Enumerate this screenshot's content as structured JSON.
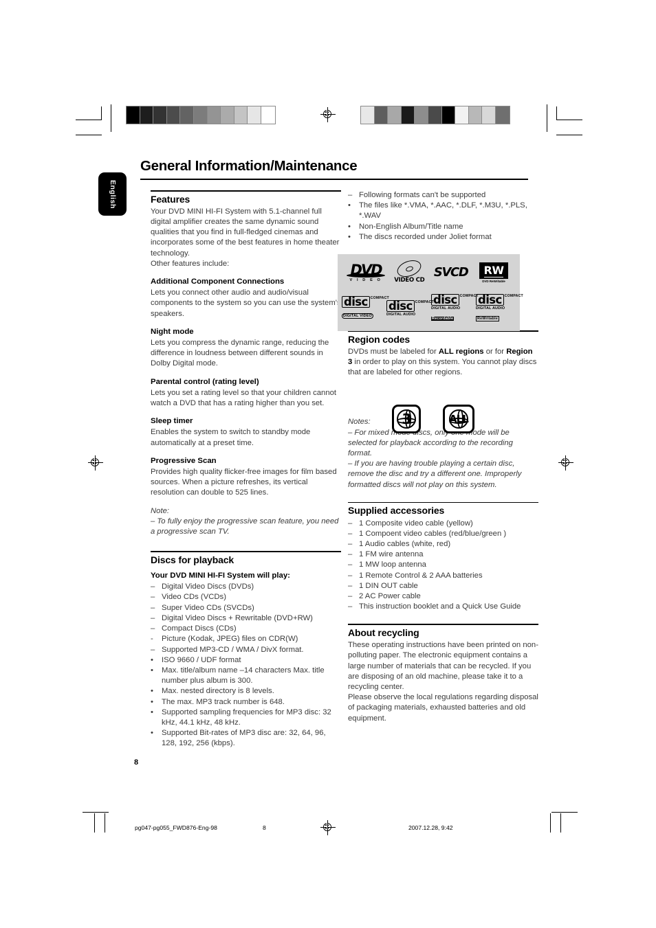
{
  "document": {
    "title": "General Information/Maintenance",
    "language_tab": "English",
    "page_number": "8"
  },
  "footer": {
    "filename": "pg047-pg055_FWD876-Eng-98",
    "page": "8",
    "timestamp": "2007.12.28, 9:42"
  },
  "left_column": {
    "features": {
      "heading": "Features",
      "intro": "Your DVD MINI HI-FI System with 5.1-channel full digital amplifier creates the same dynamic sound qualities that you find in full-fledged cinemas and incorporates some of the best features in home theater technology.",
      "intro2": "Other features include:",
      "items": [
        {
          "title": "Additional Component Connections",
          "body": "Lets you connect other audio and audio/visual components to the system so you can use the system's speakers."
        },
        {
          "title": "Night mode",
          "body": "Lets you compress the dynamic range, reducing the difference in loudness between different sounds in Dolby Digital mode."
        },
        {
          "title": "Parental control (rating level)",
          "body": "Lets you set a rating level so that your children cannot watch a DVD that has a rating higher than you set."
        },
        {
          "title": "Sleep timer",
          "body": "Enables the system to switch to standby mode automatically at a preset time."
        },
        {
          "title": "Progressive Scan",
          "body": "Provides high quality flicker-free images for film based sources.  When a picture refreshes, its vertical resolution can double to 525 lines."
        }
      ],
      "note_label": "Note:",
      "note_text": "–  To fully enjoy the progressive scan feature, you need a progressive scan TV."
    },
    "discs": {
      "heading": "Discs for playback",
      "subheading": "Your DVD MINI HI-FI System will play:",
      "list": [
        {
          "marker": "–",
          "text": "Digital Video Discs (DVDs)"
        },
        {
          "marker": "–",
          "text": "Video CDs (VCDs)"
        },
        {
          "marker": "–",
          "text": "Super Video CDs (SVCDs)"
        },
        {
          "marker": "–",
          "text": "Digital Video Discs + Rewritable (DVD+RW)"
        },
        {
          "marker": "–",
          "text": "Compact Discs (CDs)"
        },
        {
          "marker": "-",
          "text": "Picture (Kodak, JPEG) files on CDR(W)"
        },
        {
          "marker": "–",
          "text": "Supported MP3-CD / WMA / DivX format."
        },
        {
          "marker": "•",
          "text": "ISO 9660 / UDF format"
        },
        {
          "marker": "•",
          "text": "Max. title/album name –14 characters Max. title number plus album is 300."
        },
        {
          "marker": "•",
          "text": "Max. nested directory is 8 levels."
        },
        {
          "marker": "•",
          "text": "The max. MP3 track number is 648."
        },
        {
          "marker": "•",
          "text": "Supported sampling frequencies for MP3 disc: 32 kHz, 44.1 kHz, 48 kHz."
        },
        {
          "marker": "•",
          "text": "Supported Bit-rates of MP3 disc are: 32, 64, 96, 128, 192, 256 (kbps)."
        }
      ]
    }
  },
  "right_column": {
    "unsupported": [
      {
        "marker": "–",
        "text": "Following formats can't be supported"
      },
      {
        "marker": "•",
        "text": "The files like *.VMA, *.AAC, *.DLF, *.M3U, *.PLS, *.WAV"
      },
      {
        "marker": "•",
        "text": "Non-English Album/Title name"
      },
      {
        "marker": "•",
        "text": "The discs recorded under Joliet format"
      }
    ],
    "logo_panel": {
      "logos": [
        {
          "name": "dvd-video-logo",
          "primary": "DVD",
          "secondary": "V I D E O"
        },
        {
          "name": "video-cd-logo",
          "primary": "",
          "secondary": "VIDEO CD"
        },
        {
          "name": "svcd-logo",
          "primary": "SVCD",
          "secondary": ""
        },
        {
          "name": "dvd-rewritable-logo",
          "primary": "RW",
          "secondary": "DVD ReWritable"
        },
        {
          "name": "compact-disc-digital-video-logo",
          "top": "COMPACT",
          "primary": "disc",
          "secondary": "DIGITAL VIDEO",
          "tertiary": ""
        },
        {
          "name": "compact-disc-digital-audio-logo",
          "top": "COMPACT",
          "primary": "disc",
          "secondary": "DIGITAL AUDIO",
          "tertiary": ""
        },
        {
          "name": "compact-disc-recordable-logo",
          "top": "COMPACT",
          "primary": "disc",
          "secondary": "DIGITAL AUDIO",
          "tertiary": "Recordable"
        },
        {
          "name": "compact-disc-rewritable-logo",
          "top": "COMPACT",
          "primary": "disc",
          "secondary": "DIGITAL AUDIO",
          "tertiary": "ReWritable"
        }
      ]
    },
    "region": {
      "heading": "Region codes",
      "text_part1": "DVDs must be labeled for ",
      "text_bold1": "ALL regions",
      "text_part2": " or for ",
      "text_bold2": "Region 3",
      "text_part3": "  in order to play on this system. You cannot play discs that are labeled for other regions.",
      "icon_region": "3",
      "icon_all": "ALL",
      "notes_label": "Notes:",
      "note1": "–  For mixed mode discs, only one mode will be selected for playback according to the recording format.",
      "note2": "–  If you are having trouble playing a certain disc, remove the disc and try a different one. Improperly formatted discs will not play on this system."
    },
    "accessories": {
      "heading": "Supplied accessories",
      "items": [
        "1  Composite video cable (yellow)",
        "1  Compoent video cables (red/blue/green )",
        "1 Audio cables (white, red)",
        "1 FM wire antenna",
        "1 MW loop antenna",
        "1 Remote Control & 2  AAA  batteries",
        "1 DIN OUT cable",
        "2 AC Power cable",
        "This instruction booklet and a Quick Use Guide"
      ]
    },
    "recycling": {
      "heading": "About  recycling",
      "body1": " These operating instructions have been printed on non-polluting paper. The electronic equipment contains a  large number of materials that can be recycled. If you are disposing of an old machine, please take it to a  recycling center.",
      "body2": "Please observe the local regulations regarding disposal of packaging materials, exhausted batteries and old equipment."
    }
  },
  "print_marks": {
    "left_wedge": [
      "#000000",
      "#1d1d1d",
      "#333333",
      "#4c4c4c",
      "#636363",
      "#7c7c7c",
      "#949494",
      "#ababab",
      "#c4c4c4",
      "#e6e6e6",
      "#ffffff"
    ],
    "right_wedge": [
      "#e8e8e8",
      "#5e5e5e",
      "#a8a8a8",
      "#1a1a1a",
      "#8d8d8d",
      "#4a4a4a",
      "#000000",
      "#f2f2f2",
      "#b8b8b8",
      "#d8d8d8",
      "#6f6f6f"
    ]
  }
}
